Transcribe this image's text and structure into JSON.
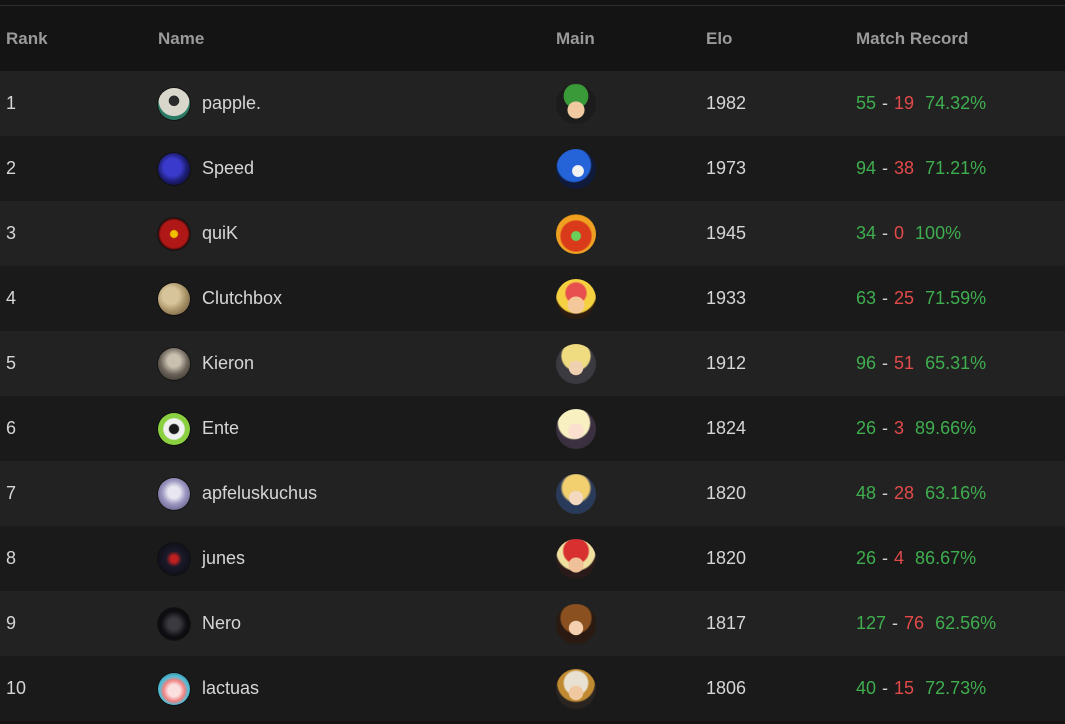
{
  "columns": {
    "rank": "Rank",
    "name": "Name",
    "main": "Main",
    "elo": "Elo",
    "record": "Match Record"
  },
  "rows": [
    {
      "rank": "1",
      "name": "papple.",
      "elo": "1982",
      "wins": "55",
      "losses": "19",
      "pct": "74.32%"
    },
    {
      "rank": "2",
      "name": "Speed",
      "elo": "1973",
      "wins": "94",
      "losses": "38",
      "pct": "71.21%"
    },
    {
      "rank": "3",
      "name": "quiK",
      "elo": "1945",
      "wins": "34",
      "losses": "0",
      "pct": "100%"
    },
    {
      "rank": "4",
      "name": "Clutchbox",
      "elo": "1933",
      "wins": "63",
      "losses": "25",
      "pct": "71.59%"
    },
    {
      "rank": "5",
      "name": "Kieron",
      "elo": "1912",
      "wins": "96",
      "losses": "51",
      "pct": "65.31%"
    },
    {
      "rank": "6",
      "name": "Ente",
      "elo": "1824",
      "wins": "26",
      "losses": "3",
      "pct": "89.66%"
    },
    {
      "rank": "7",
      "name": "apfeluskuchus",
      "elo": "1820",
      "wins": "48",
      "losses": "28",
      "pct": "63.16%"
    },
    {
      "rank": "8",
      "name": "junes",
      "elo": "1820",
      "wins": "26",
      "losses": "4",
      "pct": "86.67%"
    },
    {
      "rank": "9",
      "name": "Nero",
      "elo": "1817",
      "wins": "127",
      "losses": "76",
      "pct": "62.56%"
    },
    {
      "rank": "10",
      "name": "lactuas",
      "elo": "1806",
      "wins": "40",
      "losses": "15",
      "pct": "72.73%"
    }
  ],
  "colors": {
    "win": "#3fae4f",
    "loss": "#e24a4a"
  }
}
